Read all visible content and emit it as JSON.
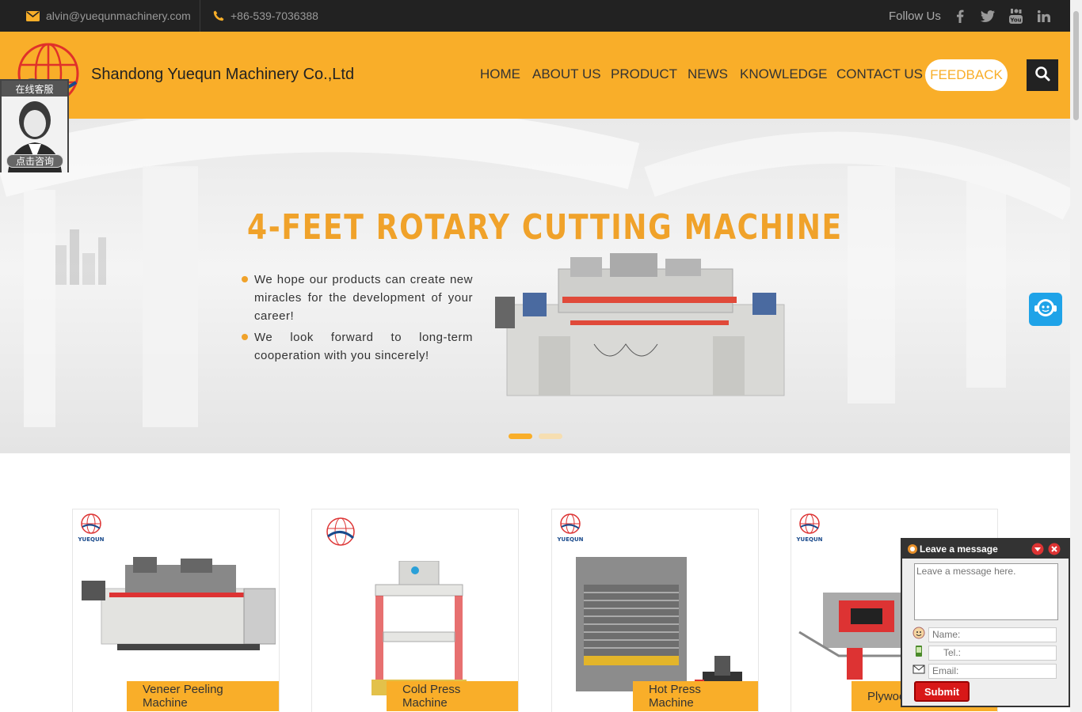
{
  "topbar": {
    "email": "alvin@yuequnmachinery.com",
    "phone": "+86-539-7036388",
    "follow_label": "Follow Us",
    "social": [
      "facebook-icon",
      "twitter-icon",
      "youtube-icon",
      "linkedin-icon"
    ]
  },
  "header": {
    "company": "Shandong Yuequn Machinery Co.,Ltd",
    "nav": [
      "HOME",
      "ABOUT US",
      "PRODUCT",
      "NEWS",
      "KNOWLEDGE",
      "CONTACT US"
    ],
    "feedback": "FEEDBACK"
  },
  "hero": {
    "title": "4-FEET ROTARY CUTTING MACHINE",
    "bullets": [
      "We hope our products can create new miracles for the development of your career!",
      "We look forward to long-term cooperation with you sincerely!"
    ],
    "slide_count": 2,
    "active_slide": 1
  },
  "products": [
    {
      "label": "Veneer Peeling Machine",
      "brand": "YUEQUN"
    },
    {
      "label": "Cold Press Machine",
      "brand": ""
    },
    {
      "label": "Hot Press Machine",
      "brand": "YUEQUN"
    },
    {
      "label": "Plywood",
      "brand": "YUEQUN"
    }
  ],
  "chat_widget": {
    "title": "在线客服",
    "button": "点击咨询"
  },
  "leave_message": {
    "title": "Leave a message",
    "message_placeholder": "Leave a message here.",
    "name_placeholder": "Name:",
    "tel_placeholder": "Tel.:",
    "email_placeholder": "Email:",
    "submit": "Submit"
  },
  "colors": {
    "brand_orange": "#f9ae29",
    "topbar_dark": "#222222",
    "title_orange": "#f0a22a"
  }
}
